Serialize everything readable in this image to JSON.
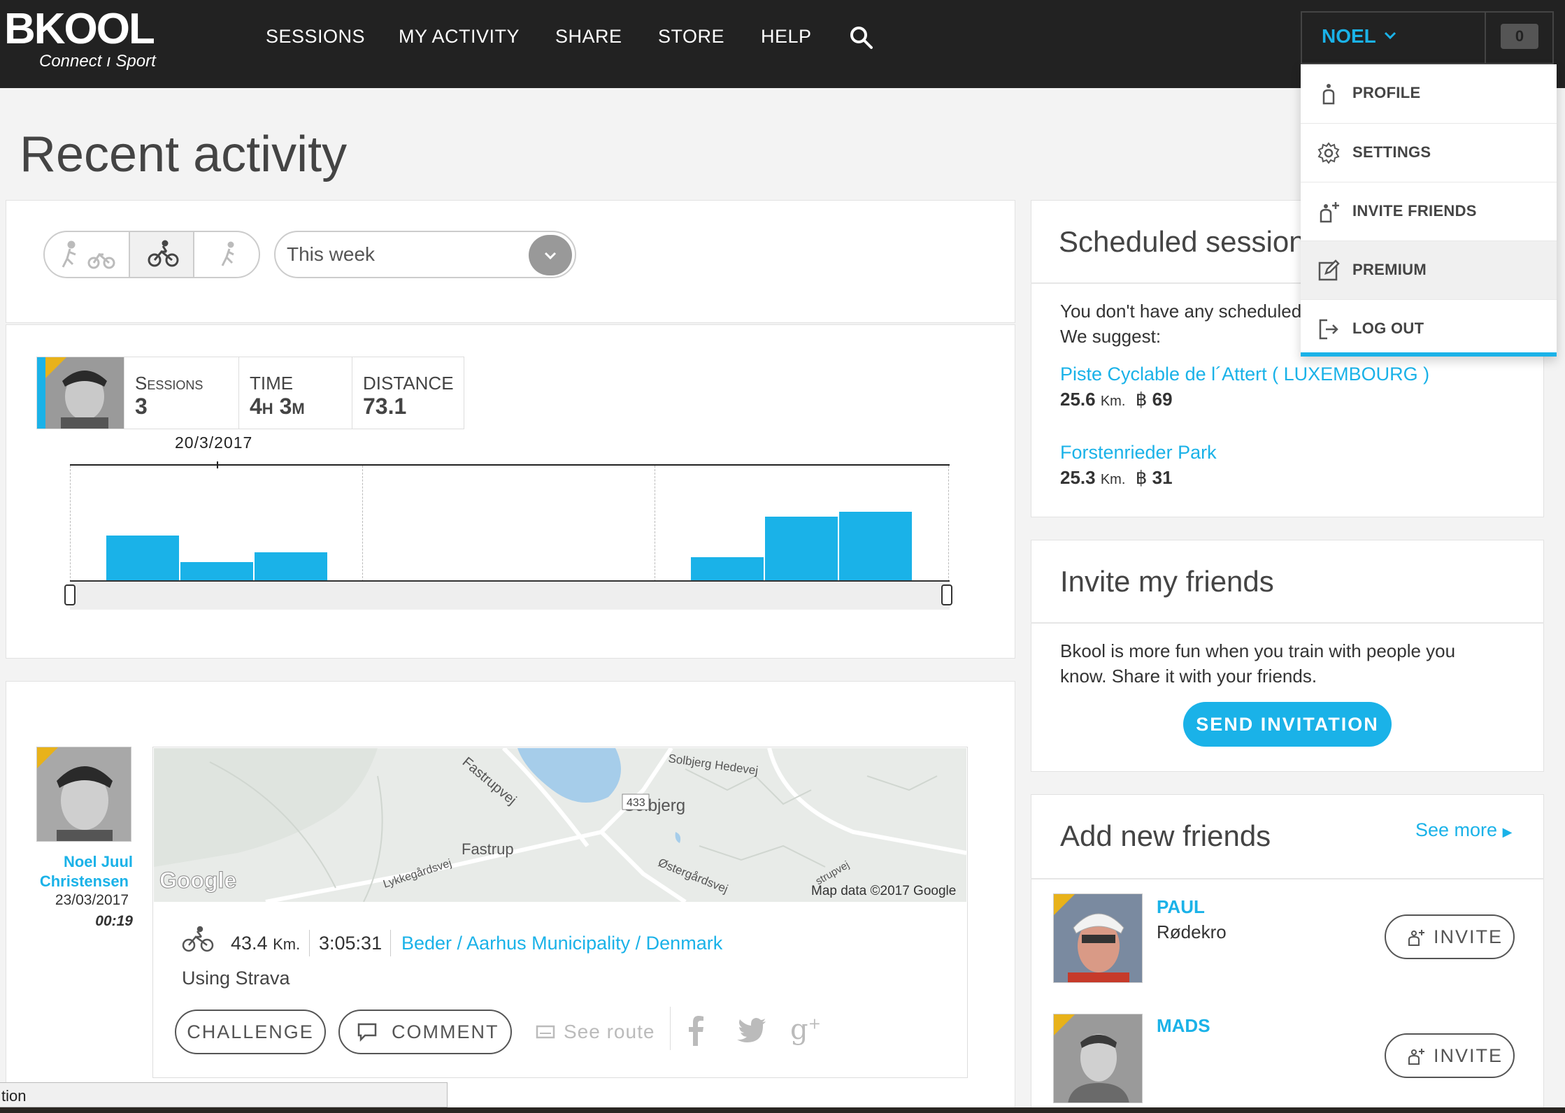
{
  "brand": {
    "name": "BKOOL",
    "tagline": "Connect ı Sport"
  },
  "nav": {
    "items": [
      "SESSIONS",
      "MY ACTIVITY",
      "SHARE",
      "STORE",
      "HELP"
    ],
    "search_icon": "search-icon"
  },
  "user": {
    "name": "NOEL",
    "messages_count": "0"
  },
  "user_menu": {
    "items": [
      {
        "label": "PROFILE",
        "icon": "person-icon"
      },
      {
        "label": "SETTINGS",
        "icon": "gear-icon"
      },
      {
        "label": "INVITE FRIENDS",
        "icon": "add-user-icon"
      },
      {
        "label": "PREMIUM",
        "icon": "edit-icon"
      },
      {
        "label": "LOG OUT",
        "icon": "logout-icon"
      }
    ]
  },
  "page": {
    "title": "Recent activity"
  },
  "filters": {
    "period": "This week"
  },
  "stats": {
    "sessions_label": "Sessions",
    "sessions_value": "3",
    "time_label": "TIME",
    "time_value": "4h 3m",
    "distance_label": "DISTANCE",
    "distance_value": "73.1"
  },
  "chart_data": {
    "type": "bar",
    "marker_label": "20/3/2017",
    "groups": [
      {
        "values": [
          0.4,
          0.17,
          0.25
        ]
      },
      {
        "values": []
      },
      {
        "values": [
          0.21,
          0.56,
          0.6
        ]
      }
    ]
  },
  "activity": {
    "user_name_line1": "Noel Juul",
    "user_name_line2": "Christensen",
    "date": "23/03/2017",
    "time": "00:19",
    "map": {
      "labels": [
        "Fastrupvej",
        "Solbjerg Hedevej",
        "433",
        "Solbjerg",
        "Fastrup",
        "Lykkegårdsvej",
        "Østergårdsvej",
        "strupvej"
      ],
      "google": "Google",
      "attribution": "Map data ©2017 Google"
    },
    "distance": "43.4",
    "distance_unit": "Km.",
    "duration": "3:05:31",
    "location": "Beder / Aarhus Municipality / Denmark",
    "source": "Using Strava",
    "challenge_label": "CHALLENGE",
    "comment_label": "COMMENT",
    "see_route_label": "See route"
  },
  "scheduled": {
    "title": "Scheduled sessions",
    "empty_line1": "You don't have any scheduled sessions.",
    "empty_line2": "We suggest:",
    "suggestions": [
      {
        "name": "Piste Cyclable de l´Attert ( LUXEMBOURG )",
        "km": "25.6",
        "unit": "Km.",
        "coins": "69"
      },
      {
        "name": "Forstenrieder Park",
        "km": "25.3",
        "unit": "Km.",
        "coins": "31"
      }
    ]
  },
  "invite": {
    "title": "Invite my friends",
    "text_line1": "Bkool is more fun when you train with people you",
    "text_line2": "know. Share it with your friends.",
    "button": "SEND INVITATION"
  },
  "add_friends": {
    "title": "Add new friends",
    "see_more": "See more",
    "friends": [
      {
        "name": "PAUL",
        "location": "Rødekro",
        "button": "INVITE"
      },
      {
        "name": "MADS",
        "location": "",
        "button": "INVITE"
      }
    ]
  },
  "status_bar": {
    "text": "tion"
  },
  "colors": {
    "accent": "#1ab2e8",
    "topbar": "#222222",
    "badge_corner": "#e8b21a"
  }
}
